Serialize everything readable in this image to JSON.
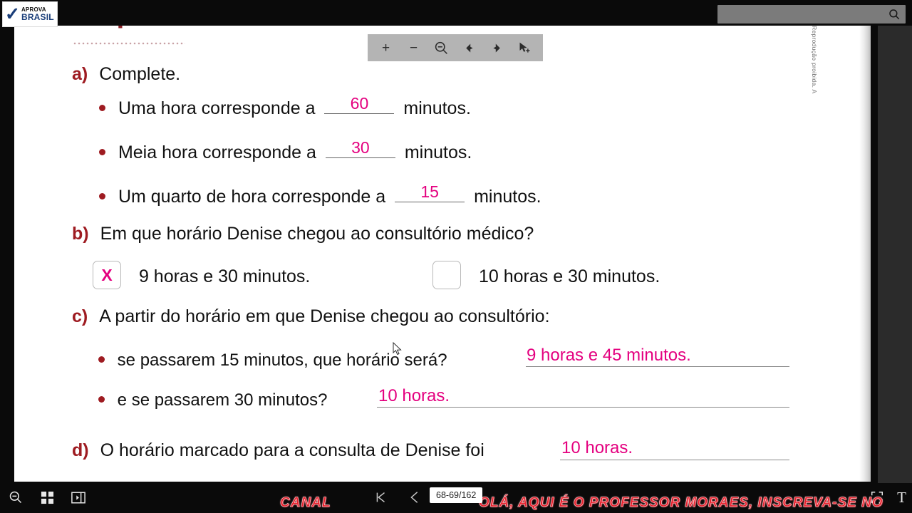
{
  "app": {
    "logo": {
      "check_icon": "check-mark",
      "line1": "APROVA",
      "line2": "BRASIL"
    },
    "search": {
      "value": "",
      "placeholder": ""
    }
  },
  "float_toolbar": {
    "buttons": [
      {
        "name": "zoom-in-button",
        "label": "+"
      },
      {
        "name": "zoom-out-button",
        "label": "−"
      },
      {
        "name": "magnifier-button",
        "label": "magnifier-minus-icon"
      },
      {
        "name": "pan-left-button",
        "label": "arrow-left-diamond-icon"
      },
      {
        "name": "pan-right-button",
        "label": "arrow-right-diamond-icon"
      },
      {
        "name": "cursor-add-button",
        "label": "cursor-plus-icon"
      }
    ]
  },
  "document": {
    "title": "Responda",
    "copyright_vertical": "Reprodução proibida. A",
    "questions": {
      "a": {
        "marker": "a)",
        "prompt": "Complete.",
        "items": [
          {
            "before": "Uma hora corresponde a",
            "answer": "60",
            "after": "minutos."
          },
          {
            "before": "Meia hora corresponde a",
            "answer": "30",
            "after": "minutos."
          },
          {
            "before": "Um quarto de hora corresponde a",
            "answer": "15",
            "after": "minutos."
          }
        ]
      },
      "b": {
        "marker": "b)",
        "prompt": "Em que horário Denise chegou ao consultório médico?",
        "options": [
          {
            "checked_mark": "X",
            "label": "9 horas e 30 minutos."
          },
          {
            "checked_mark": "",
            "label": "10 horas e 30 minutos."
          }
        ]
      },
      "c": {
        "marker": "c)",
        "prompt": "A partir do horário em que Denise chegou ao consultório:",
        "items": [
          {
            "question": "se passarem 15 minutos, que horário será?",
            "answer": "9 horas e 45 minutos."
          },
          {
            "question": "e se passarem 30 minutos?",
            "answer": "10 horas."
          }
        ]
      },
      "d": {
        "marker": "d)",
        "prompt": "O horário marcado para a consulta de Denise foi",
        "answer": "10 horas."
      }
    }
  },
  "bottom_bar": {
    "left_tools": [
      {
        "name": "zoom-out-icon"
      },
      {
        "name": "grid-view-icon"
      },
      {
        "name": "presentation-mode-icon"
      }
    ],
    "nav": {
      "first_page_label": "first-page-icon",
      "prev_page_label": "prev-page-icon"
    },
    "page_indicator": "68-69/162",
    "right_tools": [
      {
        "name": "fullscreen-icon"
      },
      {
        "name": "text-tool-icon",
        "label": "T"
      }
    ]
  },
  "overlay": {
    "marquee_text": "OLÁ, AQUI É O PROFESSOR MORAES,  INSCREVA-SE NO",
    "marquee_tail": "CANAL"
  },
  "colors": {
    "accent_pink": "#e4007f",
    "marker_red": "#9e1b21",
    "title_red": "#8d2026",
    "marquee_red": "#e81f2b",
    "bar_black": "#0a0a0a"
  }
}
